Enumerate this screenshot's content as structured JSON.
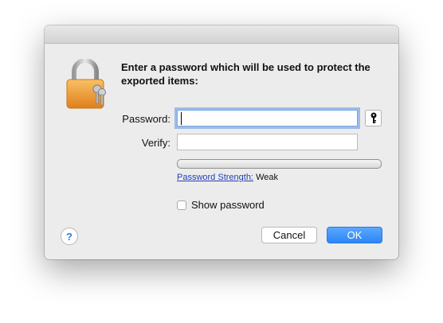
{
  "dialog": {
    "heading": "Enter a password which will be used to protect the exported items:",
    "password_label": "Password:",
    "password_value": "",
    "verify_label": "Verify:",
    "verify_value": "",
    "strength_link": "Password Strength:",
    "strength_value": "Weak",
    "strength_level": 0,
    "show_password_label": "Show password",
    "show_password_checked": false,
    "help_label": "?",
    "cancel_label": "Cancel",
    "ok_label": "OK"
  },
  "icons": {
    "lock": "padlock-with-keys-icon",
    "key": "key-icon",
    "help": "help-icon"
  },
  "colors": {
    "accent": "#2d86f5",
    "lock_body": "#f2a23a",
    "link": "#1f3fb8"
  }
}
